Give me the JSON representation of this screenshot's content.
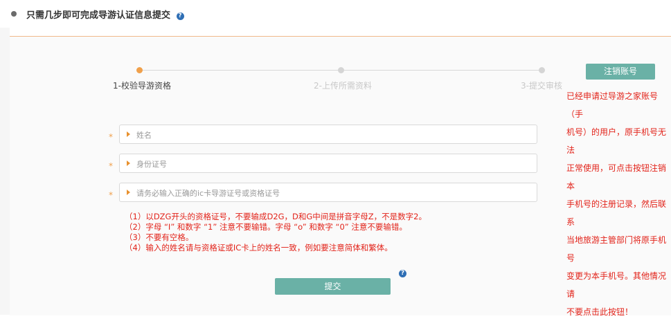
{
  "header": {
    "title": "只需几步即可完成导游认证信息提交",
    "help_glyph": "?"
  },
  "steps": [
    {
      "label": "1-校验导游资格",
      "active": true
    },
    {
      "label": "2-上传所需资料",
      "active": false
    },
    {
      "label": "3-提交审核",
      "active": false
    }
  ],
  "cancel_button": "注销账号",
  "notice_lines": [
    "已经申请过导游之家账号（手",
    "机号）的用户，原手机号无法",
    "正常使用，可点击按钮注销本",
    "手机号的注册记录，然后联系",
    "当地旅游主管部门将原手机号",
    "变更为本手机号。其他情况请",
    "不要点击此按钮！"
  ],
  "form": {
    "required_mark": "*",
    "name_placeholder": "姓名",
    "id_placeholder": "身份证号",
    "card_placeholder": "请务必输入正确的ic卡导游证号或资格证号"
  },
  "rules": [
    "（1）以DZG开头的资格证号，不要输成D2G，D和G中间是拼音字母Z，不是数字2。",
    "（2）字母 “I” 和数字 “1” 注意不要输错。字母 “o” 和数字 “0” 注意不要输错。",
    "（3）不要有空格。",
    "（4）输入的姓名请与资格证或IC卡上的姓名一致，例如要注意简体和繁体。"
  ],
  "submit_button": "提交",
  "help_glyph": "?",
  "colors": {
    "accent": "#6ab1a6",
    "warning_text": "#e2231a",
    "step_active": "#f0a04b",
    "help_icon": "#2f6fb5"
  }
}
